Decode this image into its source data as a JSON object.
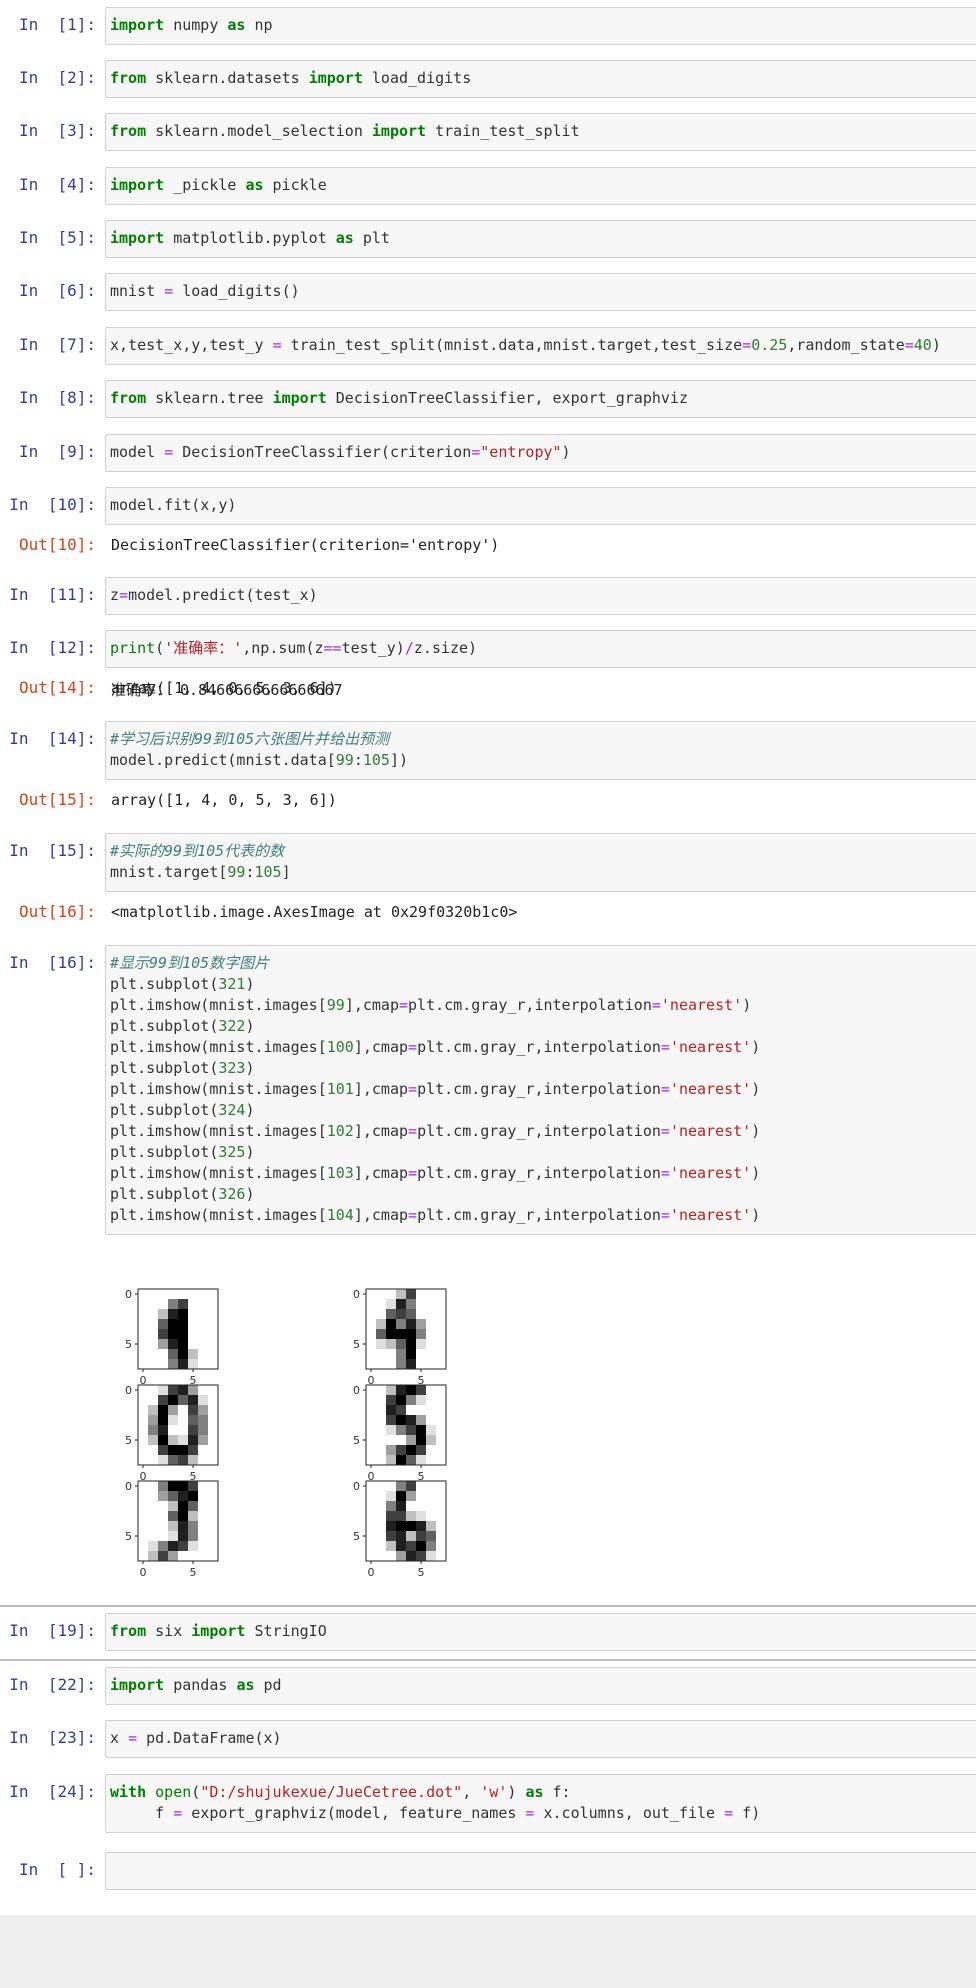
{
  "cells": [
    {
      "prompt": "In  [1]:",
      "code": "import numpy as np"
    },
    {
      "prompt": "In  [2]:",
      "code": "from sklearn.datasets import load_digits"
    },
    {
      "prompt": "In  [3]:",
      "code": "from sklearn.model_selection import train_test_split"
    },
    {
      "prompt": "In  [4]:",
      "code": "import _pickle as pickle"
    },
    {
      "prompt": "In  [5]:",
      "code": "import matplotlib.pyplot as plt"
    },
    {
      "prompt": "In  [6]:",
      "code": "mnist = load_digits()"
    },
    {
      "prompt": "In  [7]:",
      "code": "x,test_x,y,test_y = train_test_split(mnist.data,mnist.target,test_size=0.25,random_state=40)"
    },
    {
      "prompt": "In  [8]:",
      "code": "from sklearn.tree import DecisionTreeClassifier, export_graphviz"
    },
    {
      "prompt": "In  [9]:",
      "code": "model = DecisionTreeClassifier(criterion=\"entropy\")"
    },
    {
      "prompt": "In  [10]:",
      "code": "model.fit(x,y)",
      "out_prompt": "Out[10]:",
      "out": "DecisionTreeClassifier(criterion='entropy')"
    },
    {
      "prompt": "In  [11]:",
      "code": "z=model.predict(test_x)"
    },
    {
      "prompt": "In  [12]:",
      "code": "print('准确率：',np.sum(z==test_y)/z.size)",
      "stdout": "准确率： 0.8466666666666667"
    },
    {
      "prompt": "In  [14]:",
      "code": "#学习后识别99到105六张图片并给出预测\nmodel.predict(mnist.data[99:105])",
      "out_prompt": "Out[14]:",
      "out": "array([1, 4, 0, 5, 3, 6])"
    },
    {
      "prompt": "In  [15]:",
      "code": "#实际的99到105代表的数\nmnist.target[99:105]",
      "out_prompt": "Out[15]:",
      "out": "array([1, 4, 0, 5, 3, 6])"
    },
    {
      "prompt": "In  [16]:",
      "code": "#显示99到105数字图片\nplt.subplot(321)\nplt.imshow(mnist.images[99],cmap=plt.cm.gray_r,interpolation='nearest')\nplt.subplot(322)\nplt.imshow(mnist.images[100],cmap=plt.cm.gray_r,interpolation='nearest')\nplt.subplot(323)\nplt.imshow(mnist.images[101],cmap=plt.cm.gray_r,interpolation='nearest')\nplt.subplot(324)\nplt.imshow(mnist.images[102],cmap=plt.cm.gray_r,interpolation='nearest')\nplt.subplot(325)\nplt.imshow(mnist.images[103],cmap=plt.cm.gray_r,interpolation='nearest')\nplt.subplot(326)\nplt.imshow(mnist.images[104],cmap=plt.cm.gray_r,interpolation='nearest')",
      "out_prompt": "Out[16]:",
      "out": "<matplotlib.image.AxesImage at 0x29f0320b1c0>"
    },
    {
      "prompt": "In  [19]:",
      "code": "from six import StringIO"
    },
    {
      "prompt": "In  [22]:",
      "code": "import pandas as pd"
    },
    {
      "prompt": "In  [23]:",
      "code": "x = pd.DataFrame(x)"
    },
    {
      "prompt": "In  [24]:",
      "code": "with open(\"D:/shujukexue/JueCetree.dot\", 'w') as f:\n     f = export_graphviz(model, feature_names = x.columns, out_file = f)"
    },
    {
      "prompt": "In  [ ]:",
      "code": ""
    }
  ],
  "figure": {
    "ticks": [
      "0",
      "5"
    ],
    "colormap": "gray_r",
    "digit_images": [
      [
        [
          0,
          0,
          0,
          0,
          0,
          0,
          0,
          0
        ],
        [
          0,
          0,
          0,
          8,
          12,
          0,
          0,
          0
        ],
        [
          0,
          0,
          4,
          14,
          16,
          0,
          0,
          0
        ],
        [
          0,
          0,
          10,
          16,
          16,
          0,
          0,
          0
        ],
        [
          0,
          0,
          12,
          16,
          16,
          0,
          0,
          0
        ],
        [
          0,
          0,
          6,
          14,
          16,
          0,
          0,
          0
        ],
        [
          0,
          0,
          0,
          10,
          16,
          4,
          0,
          0
        ],
        [
          0,
          0,
          0,
          8,
          14,
          2,
          0,
          0
        ]
      ],
      [
        [
          0,
          0,
          0,
          4,
          12,
          0,
          0,
          0
        ],
        [
          0,
          0,
          2,
          14,
          8,
          0,
          0,
          0
        ],
        [
          0,
          0,
          10,
          12,
          10,
          0,
          0,
          0
        ],
        [
          0,
          4,
          16,
          8,
          14,
          6,
          0,
          0
        ],
        [
          0,
          10,
          16,
          16,
          16,
          8,
          0,
          0
        ],
        [
          0,
          2,
          4,
          10,
          16,
          2,
          0,
          0
        ],
        [
          0,
          0,
          0,
          8,
          16,
          0,
          0,
          0
        ],
        [
          0,
          0,
          0,
          8,
          14,
          0,
          0,
          0
        ]
      ],
      [
        [
          0,
          0,
          2,
          12,
          14,
          6,
          0,
          0
        ],
        [
          0,
          0,
          12,
          16,
          10,
          14,
          2,
          0
        ],
        [
          0,
          4,
          16,
          6,
          0,
          12,
          6,
          0
        ],
        [
          0,
          6,
          16,
          2,
          0,
          10,
          8,
          0
        ],
        [
          0,
          8,
          14,
          0,
          0,
          12,
          8,
          0
        ],
        [
          0,
          4,
          16,
          4,
          2,
          14,
          6,
          0
        ],
        [
          0,
          0,
          12,
          16,
          16,
          12,
          0,
          0
        ],
        [
          0,
          0,
          2,
          10,
          12,
          4,
          0,
          0
        ]
      ],
      [
        [
          0,
          0,
          4,
          14,
          16,
          12,
          0,
          0
        ],
        [
          0,
          0,
          12,
          16,
          8,
          2,
          0,
          0
        ],
        [
          0,
          0,
          14,
          12,
          0,
          0,
          0,
          0
        ],
        [
          0,
          0,
          12,
          16,
          14,
          6,
          0,
          0
        ],
        [
          0,
          0,
          2,
          8,
          12,
          16,
          2,
          0
        ],
        [
          0,
          0,
          0,
          0,
          6,
          16,
          4,
          0
        ],
        [
          0,
          0,
          6,
          12,
          16,
          12,
          0,
          0
        ],
        [
          0,
          0,
          4,
          16,
          10,
          2,
          0,
          0
        ]
      ],
      [
        [
          0,
          0,
          8,
          16,
          16,
          12,
          0,
          0
        ],
        [
          0,
          0,
          6,
          10,
          14,
          16,
          0,
          0
        ],
        [
          0,
          0,
          0,
          4,
          16,
          10,
          0,
          0
        ],
        [
          0,
          0,
          0,
          10,
          16,
          4,
          0,
          0
        ],
        [
          0,
          0,
          0,
          4,
          14,
          8,
          0,
          0
        ],
        [
          0,
          0,
          0,
          2,
          14,
          8,
          0,
          0
        ],
        [
          0,
          2,
          8,
          14,
          12,
          2,
          0,
          0
        ],
        [
          0,
          4,
          12,
          6,
          0,
          0,
          0,
          0
        ]
      ],
      [
        [
          0,
          0,
          0,
          8,
          12,
          0,
          0,
          0
        ],
        [
          0,
          0,
          2,
          16,
          6,
          0,
          0,
          0
        ],
        [
          0,
          0,
          8,
          14,
          0,
          0,
          0,
          0
        ],
        [
          0,
          0,
          12,
          12,
          4,
          2,
          0,
          0
        ],
        [
          0,
          0,
          14,
          16,
          16,
          14,
          4,
          0
        ],
        [
          0,
          0,
          12,
          14,
          4,
          12,
          10,
          0
        ],
        [
          0,
          0,
          4,
          14,
          12,
          16,
          8,
          0
        ],
        [
          0,
          0,
          0,
          6,
          14,
          12,
          2,
          0
        ]
      ]
    ]
  }
}
